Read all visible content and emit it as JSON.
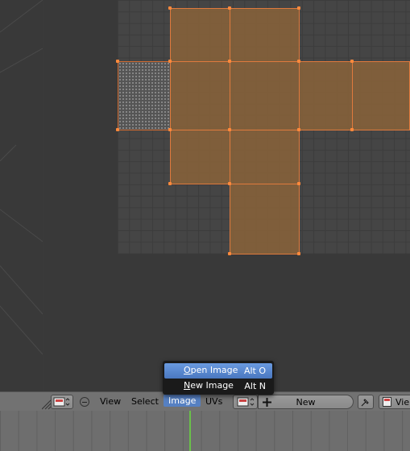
{
  "header": {
    "menus": {
      "view": "View",
      "select": "Select",
      "image": "Image",
      "uvs": "UVs"
    },
    "new_button": "New",
    "view_label": "Vie"
  },
  "image_menu": {
    "items": [
      {
        "label_prefix": "",
        "mnemonic": "O",
        "label_rest": "pen Image",
        "shortcut": "Alt O"
      },
      {
        "label_prefix": "",
        "mnemonic": "N",
        "label_rest": "ew Image",
        "shortcut": "Alt N"
      }
    ]
  },
  "colors": {
    "face_fill": "#85613a",
    "edge": "#e07a3d",
    "highlight": "#5680c2",
    "playhead": "#6ac04a"
  },
  "icons": [
    "editor-type-icon",
    "collapse-icon",
    "image-browse-icon",
    "add-icon",
    "pin-icon",
    "view-icon"
  ]
}
